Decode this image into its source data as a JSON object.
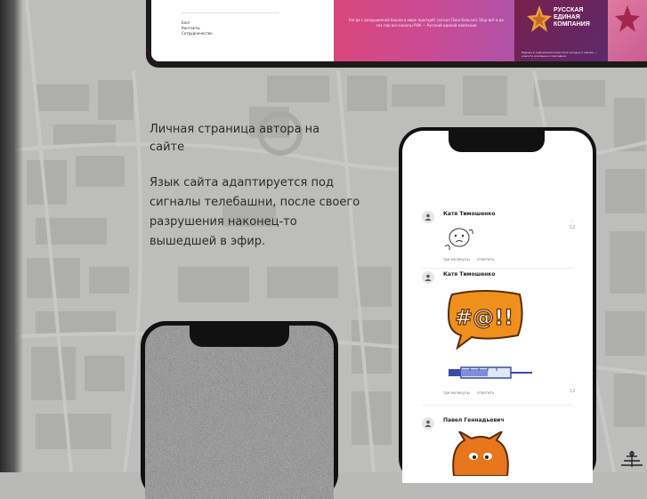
{
  "top_panel": {
    "menu": [
      "Блог",
      "Контакты",
      "Сотрудничество"
    ],
    "banner_text": "Когда с разрушенной башни в мире пропадёт сигнал Пока Бельгия, Stop всё и до сих пор все каналы РНК — Русский единой компании",
    "logo_lines": [
      "РУССКАЯ",
      "ЕДИНАЯ",
      "КОМПАНИЯ"
    ],
    "logo_caption": "Единые в информационном поле сегодня и завтра — новости компании и партнёров"
  },
  "heading": "Личная страница автора на сайте",
  "description": "Язык сайта адаптируется под сигналы телебашни, после своего разрушения наконец-то вышедшей в эфир.",
  "comments": [
    {
      "author": "Катя Тимошенко",
      "actions": [
        "три молекулы",
        "ответить"
      ],
      "likes": "12"
    },
    {
      "author": "Катя Тимошенко",
      "sticker_text": "#@!!",
      "actions": [
        "три молекулы",
        "ответить"
      ],
      "likes": "12"
    },
    {
      "author": "Павел Геннадьевич"
    }
  ],
  "colors": {
    "accent_pink": "#d9477c",
    "accent_purple": "#b052a8",
    "sticker_orange": "#f0901c"
  }
}
